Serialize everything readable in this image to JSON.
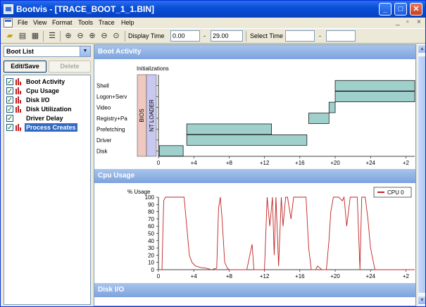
{
  "window": {
    "title": "Bootvis - [TRACE_BOOT_1_1.BIN]",
    "minimize": "_",
    "maximize": "□",
    "close": "✕"
  },
  "menu": {
    "items": [
      "File",
      "View",
      "Format",
      "Tools",
      "Trace",
      "Help"
    ],
    "mdi_controls": [
      "_",
      "▫",
      "×"
    ]
  },
  "toolbar": {
    "display_time_label": "Display Time",
    "display_time_start": "0.00",
    "display_time_sep": "-",
    "display_time_end": "29.00",
    "select_time_label": "Select Time",
    "select_time_start": "",
    "select_time_sep": "-",
    "select_time_end": ""
  },
  "left": {
    "dropdown_value": "Boot List",
    "edit_save_label": "Edit/Save",
    "delete_label": "Delete",
    "items": [
      {
        "label": "Boot Activity",
        "checked": true,
        "icon": "bar-chart-icon",
        "selected": false
      },
      {
        "label": "Cpu Usage",
        "checked": true,
        "icon": "bar-chart-icon",
        "selected": false
      },
      {
        "label": "Disk I/O",
        "checked": true,
        "icon": "bar-chart-icon",
        "selected": false
      },
      {
        "label": "Disk Utilization",
        "checked": true,
        "icon": "bar-chart-icon",
        "selected": false
      },
      {
        "label": "Driver Delay",
        "checked": true,
        "icon": "none",
        "selected": false
      },
      {
        "label": "Process Creates",
        "checked": true,
        "icon": "bar-chart-icon",
        "selected": true
      }
    ]
  },
  "sections": {
    "boot_activity": "Boot Activity",
    "cpu_usage": "Cpu Usage",
    "disk_io": "Disk I/O"
  },
  "chart_data": [
    {
      "type": "gantt",
      "title": "Boot Activity",
      "header_label": "Initializations",
      "phase_labels": [
        "BIOS",
        "NT LOADER"
      ],
      "categories": [
        "Shell",
        "Logon+Serv",
        "Video",
        "Registry+Pa",
        "Prefetching",
        "Driver",
        "Disk"
      ],
      "x_ticks": [
        "0",
        "+4",
        "+8",
        "+12",
        "+16",
        "+20",
        "+24",
        "+2"
      ],
      "xlim": [
        0,
        29
      ],
      "bars": [
        {
          "category": "Shell",
          "start": 20.0,
          "end": 29.0
        },
        {
          "category": "Logon+Serv",
          "start": 20.0,
          "end": 29.0
        },
        {
          "category": "Video",
          "start": 19.3,
          "end": 20.0
        },
        {
          "category": "Registry+Pa",
          "start": 17.0,
          "end": 19.3
        },
        {
          "category": "Prefetching",
          "start": 3.2,
          "end": 12.8
        },
        {
          "category": "Driver",
          "start": 3.2,
          "end": 16.8
        },
        {
          "category": "Disk",
          "start": 0.1,
          "end": 2.8
        }
      ],
      "colors": {
        "bar": "#a0d0cc",
        "bios": "#f0c8c0",
        "ntloader": "#c8c8f0"
      }
    },
    {
      "type": "line",
      "title": "Cpu Usage",
      "ylabel": "% Usage",
      "ylim": [
        0,
        100
      ],
      "y_ticks": [
        "0",
        "10",
        "20",
        "30",
        "40",
        "50",
        "60",
        "70",
        "80",
        "90",
        "100"
      ],
      "x_ticks": [
        "0",
        "+4",
        "+8",
        "+12",
        "+16",
        "+20",
        "+24",
        "+2"
      ],
      "xlim": [
        0,
        29
      ],
      "legend": "top-right",
      "series": [
        {
          "name": "CPU 0",
          "color": "#c02020",
          "x": [
            0.0,
            0.4,
            0.6,
            0.8,
            2.9,
            3.2,
            3.5,
            3.8,
            4.2,
            4.8,
            5.4,
            6.0,
            6.6,
            6.8,
            7.0,
            7.2,
            7.5,
            7.8,
            8.0,
            9.0,
            10.0,
            10.6,
            10.8,
            11.0,
            12.0,
            12.3,
            12.6,
            12.9,
            13.1,
            13.3,
            13.6,
            13.9,
            14.1,
            14.4,
            14.6,
            15.0,
            15.3,
            15.6,
            16.0,
            16.4,
            16.7,
            17.0,
            17.3,
            17.5,
            17.8,
            18.0,
            18.5,
            19.0,
            19.3,
            19.5,
            19.8,
            20.0,
            20.4,
            20.8,
            21.0,
            21.3,
            21.7,
            22.0,
            22.3,
            22.5,
            22.8,
            23.0,
            23.4,
            23.7,
            24.0,
            24.5,
            25.0,
            26.0,
            27.0,
            28.0,
            29.0
          ],
          "y": [
            0,
            0,
            95,
            100,
            100,
            60,
            20,
            10,
            5,
            3,
            2,
            0,
            2,
            85,
            100,
            70,
            10,
            2,
            0,
            0,
            0,
            35,
            0,
            0,
            0,
            100,
            60,
            100,
            20,
            100,
            5,
            100,
            60,
            100,
            100,
            70,
            100,
            100,
            100,
            100,
            100,
            30,
            0,
            0,
            0,
            5,
            0,
            0,
            40,
            80,
            100,
            100,
            100,
            95,
            100,
            60,
            100,
            100,
            100,
            100,
            0,
            100,
            100,
            70,
            30,
            0,
            0,
            0,
            0,
            0,
            0
          ]
        }
      ]
    }
  ]
}
